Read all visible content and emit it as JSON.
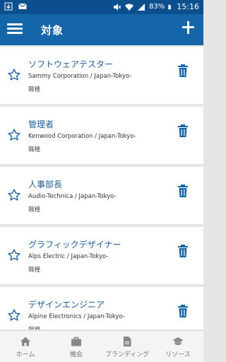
{
  "status_bar": {
    "battery": "83%",
    "time": "15:16"
  },
  "app_bar": {
    "title": "対象"
  },
  "items": [
    {
      "title": "ソフトウェアテスター",
      "company": "Sammy Corporation / Japan-Tokyo-",
      "sub": "職種"
    },
    {
      "title": "管理者",
      "company": "Kenwood Corporation / Japan-Tokyo-",
      "sub": "職種"
    },
    {
      "title": "人事部長",
      "company": "Audio-Technica / Japan-Tokyo-",
      "sub": "職種"
    },
    {
      "title": "グラフィックデザイナー",
      "company": "Alps Electric / Japan-Tokyo-",
      "sub": "職種"
    },
    {
      "title": "デザインエンジニア",
      "company": "Alpine Electronics / Japan-Tokyo-",
      "sub": "職種"
    }
  ],
  "nav": {
    "home": "ホーム",
    "jobs": "機会",
    "branding": "ブランディング",
    "resources": "リソース"
  },
  "colors": {
    "status_bar": "#0c4f8f",
    "app_bar": "#1565a9",
    "accent": "#1c5d99",
    "background": "#e6e6e6"
  },
  "icons": {
    "favorite": "star-outline-icon",
    "delete": "trash-icon",
    "menu": "hamburger-menu-icon",
    "add": "plus-icon"
  }
}
